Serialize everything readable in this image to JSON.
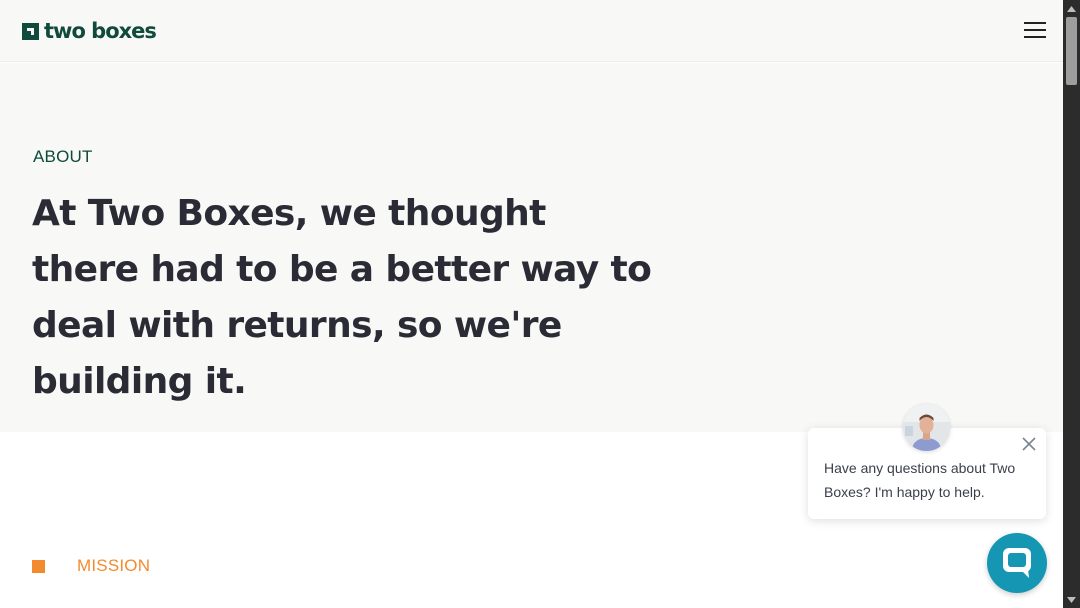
{
  "header": {
    "logo_text": "two boxes",
    "menu_icon": "hamburger-menu-icon"
  },
  "hero": {
    "eyebrow": "ABOUT",
    "headline": "At Two Boxes, we thought there had to be a better way to deal with returns, so we're building it."
  },
  "mission": {
    "label": "MISSION"
  },
  "chat": {
    "message": "Have any questions about Two Boxes? I'm happy to help.",
    "close_icon": "close-icon",
    "launcher_icon": "chat-bubble-icon"
  },
  "colors": {
    "brand_green": "#0f4a3c",
    "accent_orange": "#f28b30",
    "chat_teal": "#1596b3",
    "hero_bg": "#f8f8f6"
  }
}
